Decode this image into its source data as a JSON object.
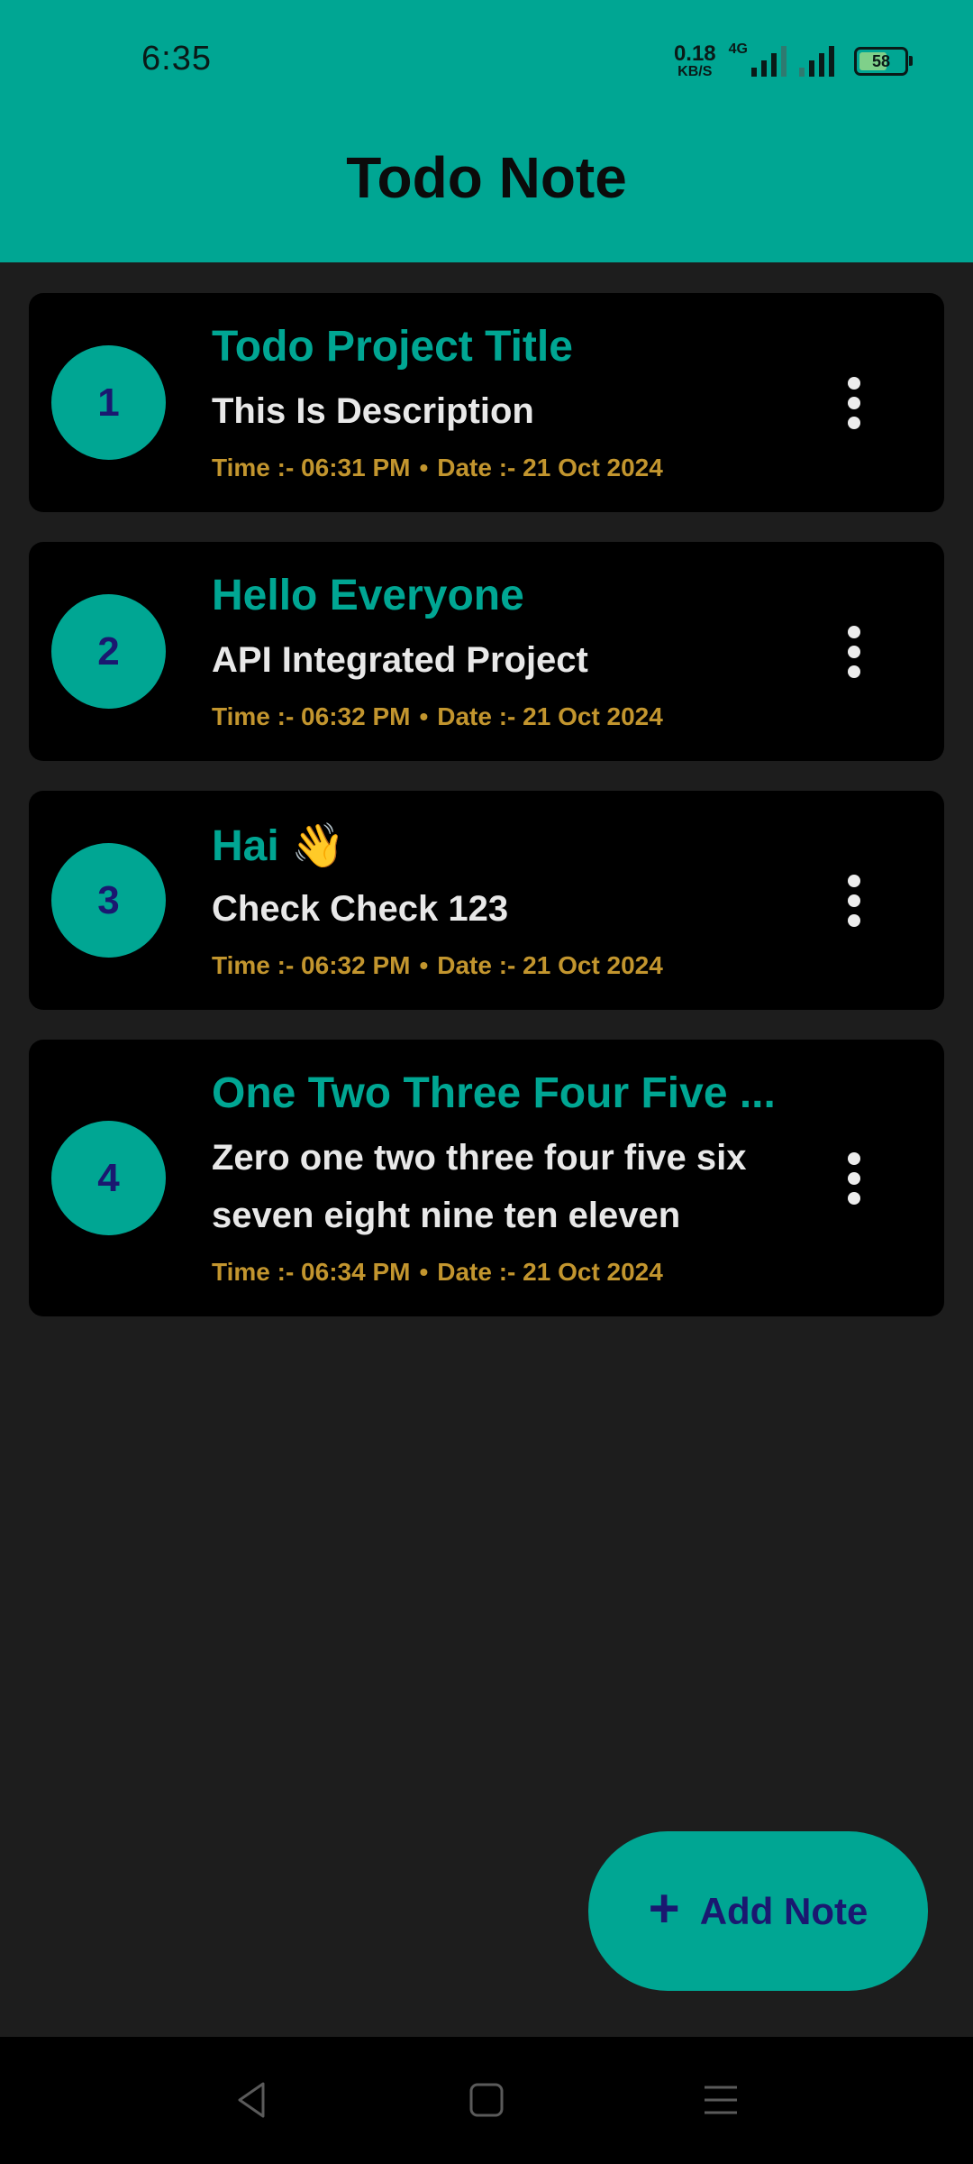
{
  "status_bar": {
    "time": "6:35",
    "net_speed_value": "0.18",
    "net_speed_unit": "KB/S",
    "network_type": "4G",
    "battery_level": "58"
  },
  "app": {
    "title": "Todo Note"
  },
  "notes": [
    {
      "number": "1",
      "title": "Todo Project Title",
      "description": "This Is Description",
      "time": "Time :- 06:31 PM",
      "date": "Date :- 21 Oct 2024"
    },
    {
      "number": "2",
      "title": "Hello Everyone",
      "description": "API Integrated Project",
      "time": "Time :- 06:32 PM",
      "date": "Date :- 21 Oct 2024"
    },
    {
      "number": "3",
      "title": "Hai 👋",
      "description": "Check Check 123",
      "time": "Time :- 06:32 PM",
      "date": "Date :- 21 Oct 2024"
    },
    {
      "number": "4",
      "title": "One Two Three Four Five ...",
      "description": "Zero one two three four five six seven eight nine ten eleven",
      "time": "Time :- 06:34 PM",
      "date": "Date :- 21 Oct 2024"
    }
  ],
  "fab": {
    "label": "Add Note",
    "icon": "plus-icon"
  },
  "separator": "•",
  "colors": {
    "accent": "#00a693",
    "background": "#1d1d1d",
    "card": "#000000",
    "meta_text": "#c2952e",
    "number_text": "#1a1870"
  },
  "nav_bar": {
    "icons": [
      "back-icon",
      "home-icon",
      "recents-icon"
    ]
  }
}
